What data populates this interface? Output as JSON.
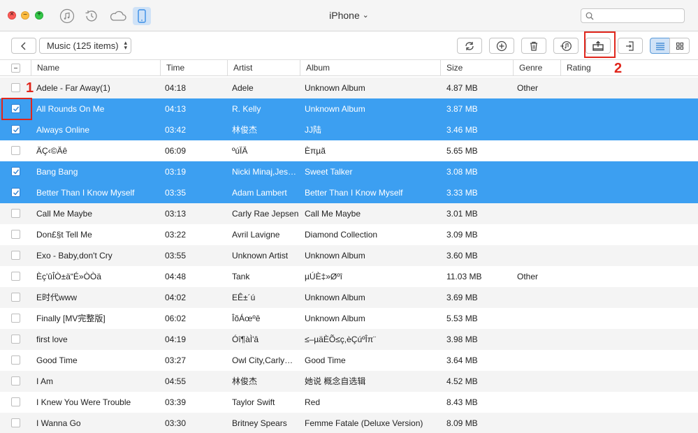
{
  "window": {
    "title": "iPhone",
    "title_chevron": "⌄",
    "search_placeholder": ""
  },
  "nav_icons": [
    "music-note-icon",
    "history-icon",
    "cloud-icon",
    "iphone-icon"
  ],
  "toolbar": {
    "category_label": "Music (125 items)",
    "buttons": [
      "refresh",
      "add",
      "delete",
      "to-itunes",
      "export-to-computer",
      "import",
      "list-view",
      "grid-view"
    ]
  },
  "columns": {
    "name": "Name",
    "time": "Time",
    "artist": "Artist",
    "album": "Album",
    "size": "Size",
    "genre": "Genre",
    "rating": "Rating"
  },
  "callouts": {
    "one": "1",
    "two": "2"
  },
  "colors": {
    "selection": "#3c9ff1",
    "callout": "#e0261c",
    "accent": "#5a9ad8"
  },
  "rows": [
    {
      "name": "Adele - Far Away(1)",
      "time": "04:18",
      "artist": "Adele",
      "album": "Unknown Album",
      "size": "4.87 MB",
      "genre": "Other",
      "selected": false
    },
    {
      "name": "All Rounds On Me",
      "time": "04:13",
      "artist": "R. Kelly",
      "album": "Unknown Album",
      "size": "3.87 MB",
      "genre": "",
      "selected": true
    },
    {
      "name": "Always Online",
      "time": "03:42",
      "artist": "林俊杰",
      "album": "JJ陆",
      "size": "3.46 MB",
      "genre": "",
      "selected": true
    },
    {
      "name": "ÄÇ‹©Äê",
      "time": "06:09",
      "artist": "ºúÏÄ",
      "album": "Èπµã",
      "size": "5.65 MB",
      "genre": "",
      "selected": false
    },
    {
      "name": "Bang Bang",
      "time": "03:19",
      "artist": "Nicki Minaj,Jes…",
      "album": "Sweet Talker",
      "size": "3.08 MB",
      "genre": "",
      "selected": true
    },
    {
      "name": "Better Than I Know Myself",
      "time": "03:35",
      "artist": "Adam Lambert",
      "album": "Better Than I Know Myself",
      "size": "3.33 MB",
      "genre": "",
      "selected": true
    },
    {
      "name": "Call Me Maybe",
      "time": "03:13",
      "artist": "Carly Rae Jepsen",
      "album": "Call Me Maybe",
      "size": "3.01 MB",
      "genre": "",
      "selected": false
    },
    {
      "name": "Don£§t Tell Me",
      "time": "03:22",
      "artist": "Avril Lavigne",
      "album": "Diamond Collection",
      "size": "3.09 MB",
      "genre": "",
      "selected": false
    },
    {
      "name": "Exo - Baby,don't Cry",
      "time": "03:55",
      "artist": "Unknown Artist",
      "album": "Unknown Album",
      "size": "3.60 MB",
      "genre": "",
      "selected": false
    },
    {
      "name": "Èç'ûÎÒ±ä“É»ÒÒä",
      "time": "04:48",
      "artist": "Tank",
      "album": "µÚÈ‡»Øºî",
      "size": "11.03 MB",
      "genre": "Other",
      "selected": false
    },
    {
      "name": "E时代www",
      "time": "04:02",
      "artist": "EÊ±´ú",
      "album": "Unknown Album",
      "size": "3.69 MB",
      "genre": "",
      "selected": false
    },
    {
      "name": "Finally [MV完整版]",
      "time": "06:02",
      "artist": "ÎõÁœºê",
      "album": "Unknown Album",
      "size": "5.53 MB",
      "genre": "",
      "selected": false
    },
    {
      "name": "first love",
      "time": "04:19",
      "artist": "Óî¶àÌ'â",
      "album": "≤–µäÈÕ≤ç,èÇúºÎπ¨",
      "size": "3.98 MB",
      "genre": "",
      "selected": false
    },
    {
      "name": "Good Time",
      "time": "03:27",
      "artist": "Owl City,Carly…",
      "album": "Good Time",
      "size": "3.64 MB",
      "genre": "",
      "selected": false
    },
    {
      "name": "I Am",
      "time": "04:55",
      "artist": "林俊杰",
      "album": "她说 概念自选辑",
      "size": "4.52 MB",
      "genre": "",
      "selected": false
    },
    {
      "name": "I Knew You Were Trouble",
      "time": "03:39",
      "artist": "Taylor Swift",
      "album": "Red",
      "size": "8.43 MB",
      "genre": "",
      "selected": false
    },
    {
      "name": "I Wanna Go",
      "time": "03:30",
      "artist": "Britney Spears",
      "album": "Femme Fatale (Deluxe Version)",
      "size": "8.09 MB",
      "genre": "",
      "selected": false
    }
  ]
}
